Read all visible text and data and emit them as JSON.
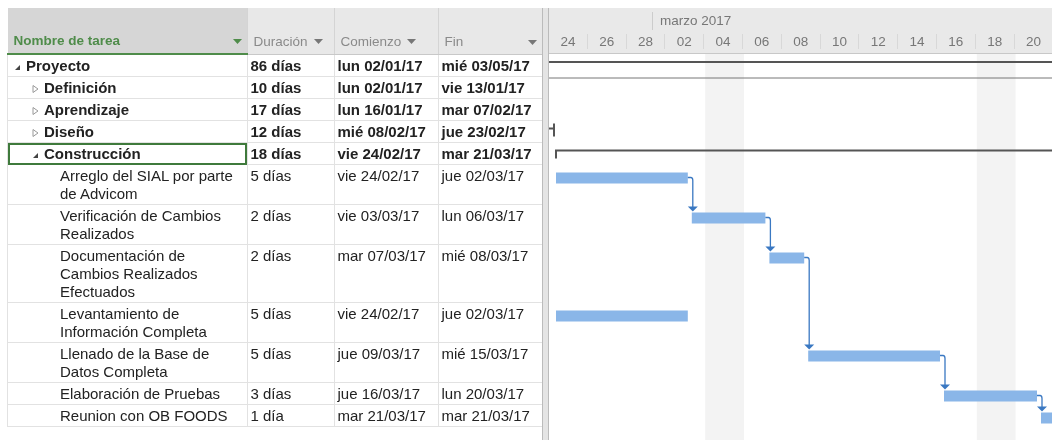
{
  "columns": [
    {
      "label": "Nombre de tarea",
      "selected": true
    },
    {
      "label": "Duración",
      "selected": false
    },
    {
      "label": "Comienzo",
      "selected": false
    },
    {
      "label": "Fin",
      "selected": false
    }
  ],
  "timescale": {
    "month": "marzo 2017",
    "days": [
      "24",
      "26",
      "28",
      "02",
      "04",
      "06",
      "08",
      "10",
      "12",
      "14",
      "16",
      "18",
      "20"
    ]
  },
  "tasks": [
    {
      "kind": "summary",
      "name": "Proyecto",
      "duration": "86 días",
      "start": "lun 02/01/17",
      "finish": "mié 03/05/17",
      "expanded": true,
      "selected": false,
      "children": [
        {
          "kind": "summary",
          "name": "Definición",
          "duration": "10 días",
          "start": "lun 02/01/17",
          "finish": "vie 13/01/17",
          "expanded": false,
          "selected": false
        },
        {
          "kind": "summary",
          "name": "Aprendizaje",
          "duration": "17 días",
          "start": "lun 16/01/17",
          "finish": "mar 07/02/17",
          "expanded": false,
          "selected": false
        },
        {
          "kind": "summary",
          "name": "Diseño",
          "duration": "12 días",
          "start": "mié 08/02/17",
          "finish": "jue 23/02/17",
          "expanded": false,
          "selected": false
        },
        {
          "kind": "summary",
          "name": "Construcción",
          "duration": "18 días",
          "start": "vie 24/02/17",
          "finish": "mar 21/03/17",
          "expanded": true,
          "selected": true,
          "children": [
            {
              "kind": "task",
              "name": "Arreglo del SIAL por parte de Advicom",
              "duration": "5 días",
              "start": "vie 24/02/17",
              "finish": "jue 02/03/17",
              "chain": true,
              "selected": false
            },
            {
              "kind": "task",
              "name": "Verificación de Cambios Realizados",
              "duration": "2 días",
              "start": "vie 03/03/17",
              "finish": "lun 06/03/17",
              "chain": true,
              "selected": false
            },
            {
              "kind": "task",
              "name": "Documentación de Cambios Realizados Efectuados",
              "duration": "2 días",
              "start": "mar 07/03/17",
              "finish": "mié 08/03/17",
              "chain": true,
              "selected": false
            },
            {
              "kind": "task",
              "name": "Levantamiento de Información Completa",
              "duration": "5 días",
              "start": "vie 24/02/17",
              "finish": "jue 02/03/17",
              "chain": false,
              "selected": false
            },
            {
              "kind": "task",
              "name": "Llenado de la Base de Datos Completa",
              "duration": "5 días",
              "start": "jue 09/03/17",
              "finish": "mié 15/03/17",
              "chain": true,
              "selected": false
            },
            {
              "kind": "task",
              "name": "Elaboración de Pruebas",
              "duration": "3 días",
              "start": "jue 16/03/17",
              "finish": "lun 20/03/17",
              "chain": true,
              "selected": false
            },
            {
              "kind": "task",
              "name": "Reunion con OB FOODS",
              "duration": "1 día",
              "start": "mar 21/03/17",
              "finish": "mar 21/03/17",
              "chain": true,
              "selected": false
            }
          ]
        }
      ]
    }
  ]
}
